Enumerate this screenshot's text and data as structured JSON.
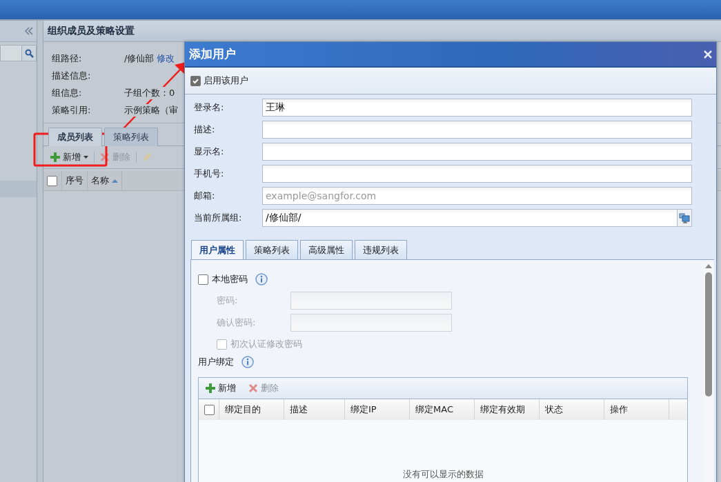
{
  "main_panel": {
    "title": "组织成员及策略设置",
    "info": [
      {
        "label": "组路径:",
        "value": "/修仙部",
        "link": "修改"
      },
      {
        "label": "描述信息:"
      },
      {
        "label": "组信息:",
        "value": "子组个数：0"
      },
      {
        "label": "策略引用:",
        "value": "示例策略（审"
      }
    ],
    "tabs": [
      {
        "label": "成员列表",
        "selected": true
      },
      {
        "label": "策略列表",
        "selected": false
      }
    ],
    "toolbar": [
      {
        "kind": "add",
        "label": "新增",
        "disabled": false,
        "dropdown": true
      },
      {
        "kind": "delete",
        "label": "删除",
        "disabled": true,
        "dropdown": false
      },
      {
        "kind": "edit",
        "disabled": true,
        "dropdown": false
      }
    ],
    "select_all": {
      "checked": false
    },
    "columns": [
      {
        "label": "序号",
        "sorted": false
      },
      {
        "label": "名称",
        "sorted": true
      }
    ]
  },
  "dialog": {
    "title": "添加用户",
    "enable": {
      "label": "启用该用户",
      "checked": true
    },
    "fields": [
      {
        "kind": "text",
        "label": "登录名:",
        "value": "王琳"
      },
      {
        "kind": "text",
        "label": "描述:"
      },
      {
        "kind": "text",
        "label": "显示名:"
      },
      {
        "kind": "text",
        "label": "手机号:"
      },
      {
        "kind": "text",
        "label": "邮箱:",
        "placeholder": "example@sangfor.com"
      },
      {
        "kind": "picker",
        "label": "当前所属组:",
        "value": "/修仙部/"
      }
    ],
    "tabs": [
      {
        "label": "用户属性",
        "selected": true
      },
      {
        "label": "策略列表",
        "selected": false
      },
      {
        "label": "高级属性",
        "selected": false
      },
      {
        "label": "违规列表",
        "selected": false
      }
    ],
    "local_password": {
      "label": "本地密码",
      "checked": false
    },
    "password_fields": [
      {
        "label": "密码:",
        "disabled": true
      },
      {
        "label": "确认密码:",
        "disabled": true
      }
    ],
    "first_login": {
      "label": "初次认证修改密码",
      "checked": false,
      "disabled": true
    },
    "binding": {
      "title": "用户绑定",
      "toolbar": [
        {
          "kind": "add",
          "label": "新增",
          "disabled": false
        },
        {
          "kind": "delete",
          "label": "删除",
          "disabled": true
        }
      ],
      "select_all": {
        "checked": false
      },
      "columns": [
        "绑定目的",
        "描述",
        "绑定IP",
        "绑定MAC",
        "绑定有效期",
        "状态",
        "操作"
      ],
      "empty_text": "没有可以显示的数据"
    }
  }
}
